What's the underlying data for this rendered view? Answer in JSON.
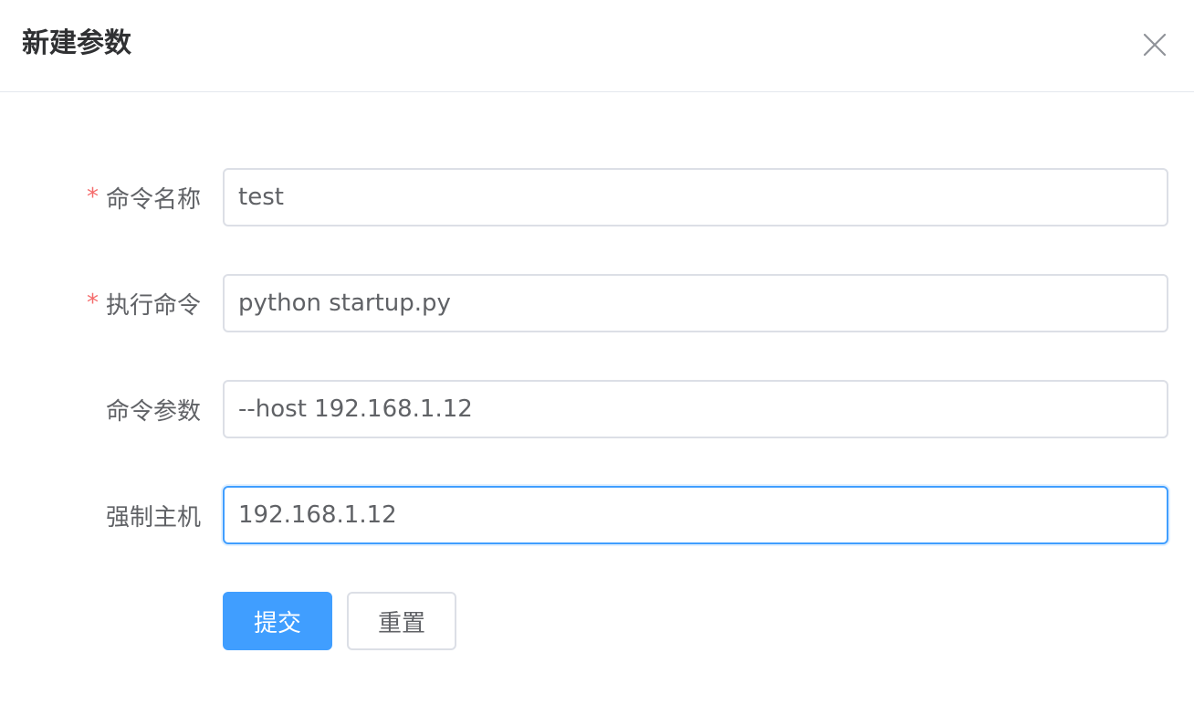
{
  "dialog": {
    "title": "新建参数",
    "close_icon": "close-icon"
  },
  "form": {
    "fields": [
      {
        "label": "命令名称",
        "required": true,
        "value": "test"
      },
      {
        "label": "执行命令",
        "required": true,
        "value": "python startup.py"
      },
      {
        "label": "命令参数",
        "required": false,
        "value": "--host 192.168.1.12"
      },
      {
        "label": "强制主机",
        "required": false,
        "value": "192.168.1.12",
        "focused": true
      }
    ],
    "required_mark": "*",
    "submit_label": "提交",
    "reset_label": "重置"
  },
  "colors": {
    "primary": "#409eff",
    "required": "#f56c6c",
    "border": "#dcdfe6",
    "text": "#606266",
    "title": "#303133"
  }
}
